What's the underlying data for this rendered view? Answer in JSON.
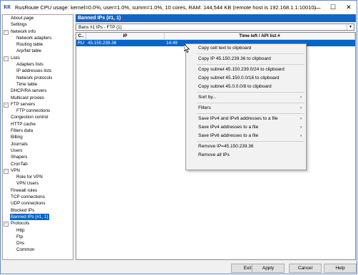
{
  "titlebar": {
    "app_icon": "RR",
    "title": "RusRoute   CPU usage: kernel=0.0%, user=1.0%, summ=1.0%, 10 cores,  RAM: 144,544 KB (remote host is 192.168.1.1:10010)",
    "minimize": "—",
    "maximize": "☐",
    "close": "✕"
  },
  "tree": [
    {
      "label": "About page",
      "level": 0,
      "exp": ""
    },
    {
      "label": "Settings",
      "level": 0,
      "exp": ""
    },
    {
      "label": "Network info",
      "level": 0,
      "exp": "−"
    },
    {
      "label": "Network adapters",
      "level": 1,
      "exp": ""
    },
    {
      "label": "Routing table",
      "level": 1,
      "exp": ""
    },
    {
      "label": "Arp/Nd table",
      "level": 1,
      "exp": ""
    },
    {
      "label": "Lists",
      "level": 0,
      "exp": "−"
    },
    {
      "label": "Adapters lists",
      "level": 1,
      "exp": ""
    },
    {
      "label": "IP addresses lists",
      "level": 1,
      "exp": ""
    },
    {
      "label": "Network protocols",
      "level": 1,
      "exp": ""
    },
    {
      "label": "Time table",
      "level": 1,
      "exp": ""
    },
    {
      "label": "DHCP/RA servers",
      "level": 0,
      "exp": ""
    },
    {
      "label": "Multicast proxies",
      "level": 0,
      "exp": ""
    },
    {
      "label": "FTP servers",
      "level": 0,
      "exp": "−"
    },
    {
      "label": "FTP connections",
      "level": 1,
      "exp": ""
    },
    {
      "label": "Congestion control",
      "level": 0,
      "exp": ""
    },
    {
      "label": "HTTP cache",
      "level": 0,
      "exp": ""
    },
    {
      "label": "Filters data",
      "level": 0,
      "exp": ""
    },
    {
      "label": "Billing",
      "level": 0,
      "exp": ""
    },
    {
      "label": "Journals",
      "level": 0,
      "exp": ""
    },
    {
      "label": "Users",
      "level": 0,
      "exp": ""
    },
    {
      "label": "Shapers",
      "level": 0,
      "exp": ""
    },
    {
      "label": "CronTab",
      "level": 0,
      "exp": ""
    },
    {
      "label": "VPN",
      "level": 0,
      "exp": "−"
    },
    {
      "label": "Role for VPN",
      "level": 1,
      "exp": ""
    },
    {
      "label": "VPN Users",
      "level": 1,
      "exp": ""
    },
    {
      "label": "Firewall rules",
      "level": 0,
      "exp": ""
    },
    {
      "label": "TCP connections",
      "level": 0,
      "exp": ""
    },
    {
      "label": "UDP connections",
      "level": 0,
      "exp": ""
    },
    {
      "label": "Blocked IPs",
      "level": 0,
      "exp": ""
    },
    {
      "label": "Banned IPs (#1, 1)",
      "level": 0,
      "exp": "",
      "selected": true
    },
    {
      "label": "Protocols",
      "level": 0,
      "exp": "−"
    },
    {
      "label": "Http",
      "level": 1,
      "exp": ""
    },
    {
      "label": "Ftp",
      "level": 1,
      "exp": ""
    },
    {
      "label": "Dns",
      "level": 1,
      "exp": ""
    },
    {
      "label": "Common",
      "level": 1,
      "exp": ""
    }
  ],
  "main": {
    "header": "Banned IPs (#1, 1)",
    "dropdown_value": "Bans #1 IPs - FTP (1)",
    "columns": [
      "C..",
      "IP",
      "Time left / API list #"
    ],
    "rows": [
      {
        "c": "RU",
        "ip": "45.150.239.36",
        "time": "14:49"
      }
    ]
  },
  "context_menu": [
    {
      "label": "Copy cell text to clipboard"
    },
    {
      "sep": true
    },
    {
      "label": "Copy IP 45.150.239.36 to clipboard"
    },
    {
      "sep": true
    },
    {
      "label": "Copy subnet 45.150.239.0/24 to clipboard"
    },
    {
      "label": "Copy subnet 45.150.0.0/16 to clipboard"
    },
    {
      "label": "Copy subnet 45.0.0.0/8 to clipboard"
    },
    {
      "sep": true
    },
    {
      "label": "Sort by...",
      "sub": true
    },
    {
      "sep": true
    },
    {
      "label": "Filters",
      "sub": true
    },
    {
      "sep": true
    },
    {
      "label": "Save IPv4 and IPv6 addresses to a file",
      "sub": true
    },
    {
      "label": "Save IPv4 addresses to a file",
      "sub": true
    },
    {
      "label": "Save IPv6 addresses to a file",
      "sub": true
    },
    {
      "sep": true
    },
    {
      "label": "Remove IP=45.150.239.36"
    },
    {
      "label": "Remove all IPs"
    }
  ],
  "buttons": {
    "exit": "Exit",
    "apply": "Apply",
    "cancel": "Cancel",
    "help": "Help"
  },
  "icons": {
    "submenu_arrow": "›",
    "dropdown_arrow": "▾"
  },
  "colors": {
    "selection": "#0a64c8",
    "header": "#1663c7"
  }
}
